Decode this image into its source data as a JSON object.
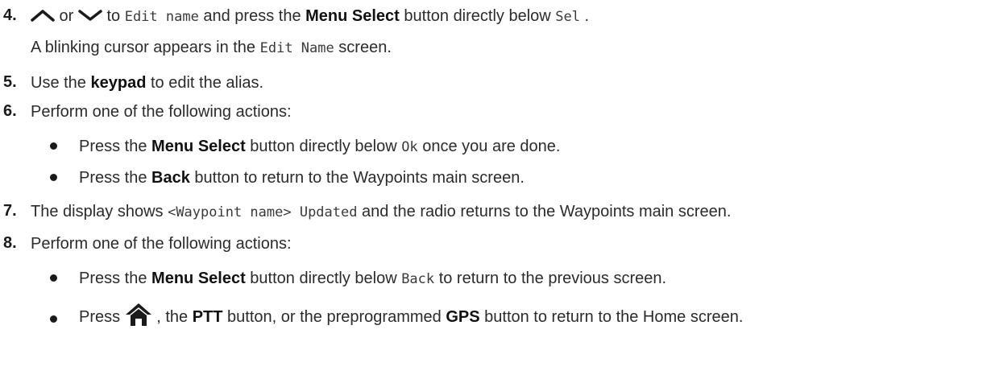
{
  "steps": {
    "s4": {
      "num": "4.",
      "or": " or ",
      "t1": " to ",
      "code1": "Edit name",
      "t2": " and press the ",
      "bold1": "Menu Select",
      "t3": " button directly below ",
      "code2": "Sel",
      "t4": " .",
      "sub_t1": "A blinking cursor appears in the ",
      "sub_code": "Edit Name",
      "sub_t2": " screen."
    },
    "s5": {
      "num": "5.",
      "t1": "Use the ",
      "bold": "keypad",
      "t2": " to edit the alias."
    },
    "s6": {
      "num": "6.",
      "text": "Perform one of the following actions:",
      "b1_t1": "Press the ",
      "b1_bold": "Menu Select",
      "b1_t2": " button directly below ",
      "b1_code": "Ok",
      "b1_t3": " once you are done.",
      "b2_t1": "Press the ",
      "b2_bold": "Back",
      "b2_t2": " button to return to the Waypoints main screen."
    },
    "s7": {
      "num": "7.",
      "t1": "The display shows ",
      "code": "<Waypoint name> Updated",
      "t2": " and the radio returns to the Waypoints main screen."
    },
    "s8": {
      "num": "8.",
      "text": "Perform one of the following actions:",
      "b1_t1": "Press the ",
      "b1_bold": "Menu Select",
      "b1_t2": " button directly below ",
      "b1_code": "Back",
      "b1_t3": " to return to the previous screen.",
      "b2_t1": "Press ",
      "b2_t2": " , the ",
      "b2_bold1": "PTT",
      "b2_t3": " button, or the preprogrammed ",
      "b2_bold2": "GPS",
      "b2_t4": " button to return to the Home screen."
    }
  },
  "icons": [
    "up-arrow-icon",
    "down-arrow-icon",
    "home-icon"
  ]
}
